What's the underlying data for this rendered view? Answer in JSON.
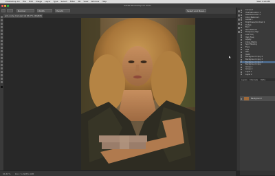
{
  "menubar": {
    "apple": "",
    "items": [
      "Photoshop CC",
      "File",
      "Edit",
      "Image",
      "Layer",
      "Type",
      "Select",
      "Filter",
      "3D",
      "View",
      "Window",
      "Help"
    ],
    "right": [
      "Wed 4:20 PM"
    ]
  },
  "titlebar": {
    "title": "Adobe Photoshop CC 2017"
  },
  "options": {
    "fields": [
      "Normal",
      "Width",
      "Height",
      "Select and Mask..."
    ]
  },
  "document": {
    "tab_label": "girl_curly_hair.psd @ 66.7% (RGB/8)"
  },
  "statusbar": {
    "zoom": "66.67%",
    "doc_info": "Doc: 5.49M/5.49M"
  },
  "layers": {
    "rows": [
      "Curves 1",
      "Hue/Saturation 1",
      "Selective Color 1",
      "Color Balance 1",
      "Levels 1",
      "Brightness/Contrast 1",
      "Dodge",
      "Burn",
      "Skin Retouch",
      "Frequency Sep",
      "Low Freq",
      "High Freq",
      "Liquify",
      "Clone Stamp",
      "Spot Healing",
      "Eyes",
      "Lips",
      "Hair",
      "Teeth",
      "Background copy 4",
      "Background copy 3",
      "Background copy 2",
      "Background copy",
      "Group 1",
      "Group 2",
      "Layer 1",
      "Layer 2"
    ],
    "selected_index": 21,
    "tabs": [
      "Layers",
      "Channels",
      "Paths"
    ],
    "background_label": "Background"
  },
  "colors": {
    "accent": "#4d6a8c",
    "panel": "#3a3a3a",
    "canvas": "#282828"
  }
}
